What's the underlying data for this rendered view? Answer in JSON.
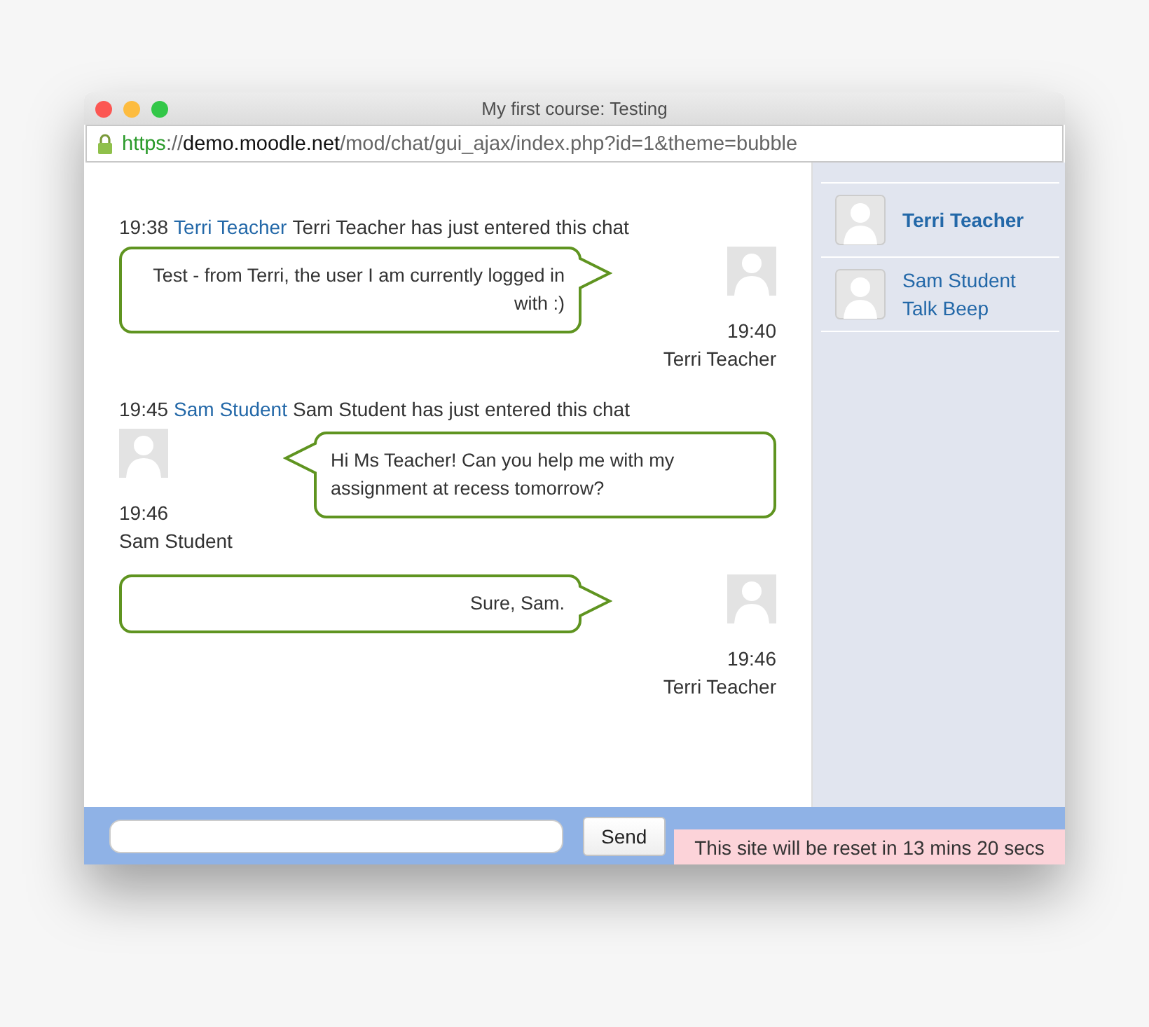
{
  "window": {
    "title": "My first course: Testing"
  },
  "address_bar": {
    "scheme": "https",
    "separator": "://",
    "host": "demo.moodle.net",
    "path": "/mod/chat/gui_ajax/index.php?id=1&theme=bubble"
  },
  "messages": [
    {
      "kind": "system",
      "time": "19:38",
      "user": "Terri Teacher",
      "text": "Terri Teacher has just entered this chat"
    },
    {
      "kind": "mine",
      "text": "Test - from Terri, the user I am currently logged in with :)",
      "time": "19:40",
      "user": "Terri Teacher"
    },
    {
      "kind": "system",
      "time": "19:45",
      "user": "Sam Student",
      "text": "Sam Student has just entered this chat"
    },
    {
      "kind": "other",
      "text": "Hi Ms Teacher! Can you help me with my assignment at recess tomorrow?",
      "time": "19:46",
      "user": "Sam Student"
    },
    {
      "kind": "mine",
      "text": "Sure, Sam.",
      "time": "19:46",
      "user": "Terri Teacher"
    }
  ],
  "users": [
    {
      "name": "Terri Teacher",
      "selected": true
    },
    {
      "name": "Sam Student",
      "action": "Talk Beep",
      "selected": false
    }
  ],
  "composer": {
    "send_button": "Send"
  },
  "reset_notice": "This site will be reset in 13 mins 20 secs"
}
